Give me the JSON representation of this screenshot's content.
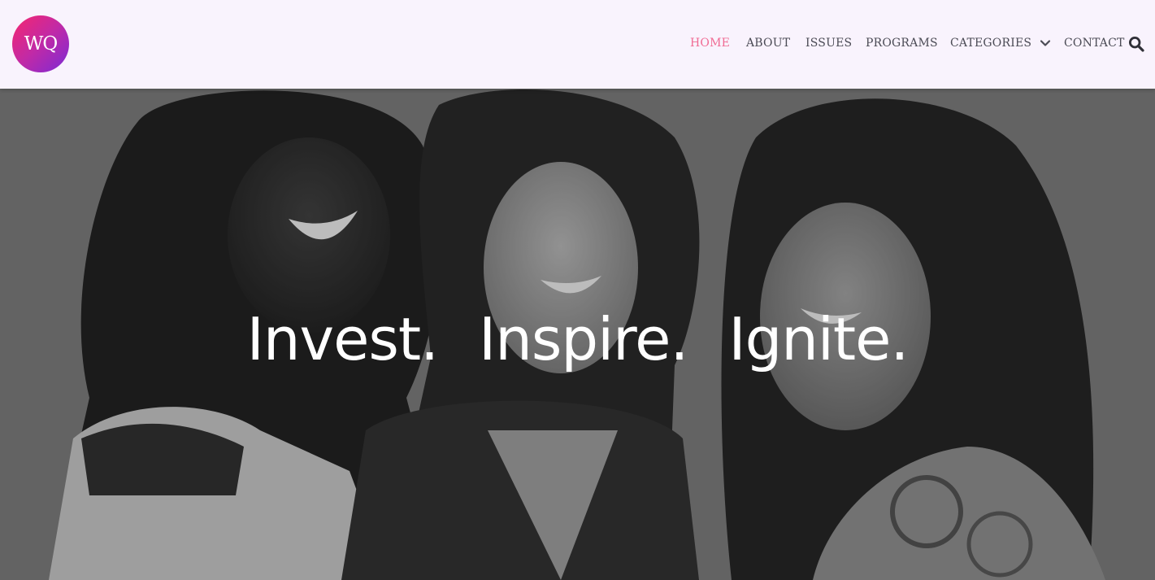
{
  "logo": {
    "text": "WQ"
  },
  "nav": {
    "items": [
      {
        "label": "HOME",
        "active": true
      },
      {
        "label": "ABOUT"
      },
      {
        "label": "ISSUES"
      },
      {
        "label": "PROGRAMS"
      },
      {
        "label": "CATEGORIES",
        "has_dropdown": true
      },
      {
        "label": "CONTACT"
      }
    ],
    "search_icon": "search-icon"
  },
  "hero": {
    "tagline": [
      "Invest.",
      "Inspire.",
      "Ignite."
    ]
  },
  "colors": {
    "active_nav": "#f06b93",
    "nav_text": "#4b4b55",
    "header_bg": "#f9f3fd",
    "logo_gradient": [
      "#f6266e",
      "#7a2bd6"
    ]
  }
}
